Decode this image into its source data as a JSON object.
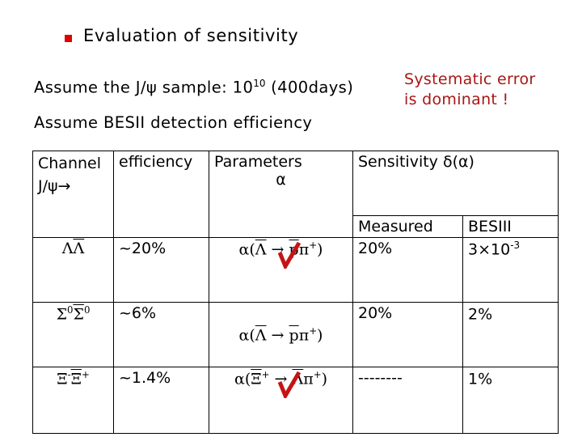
{
  "slide": {
    "title": "Evaluation of sensitivity",
    "bullet_color": "#e00000",
    "assumptions": {
      "sample_prefix": "Assume the J/ψ sample: 10",
      "sample_exponent": "10",
      "sample_suffix": "(400days)",
      "efficiency_line": "Assume BESII detection efficiency"
    },
    "note": {
      "line1": "Systematic error",
      "line2": "is dominant !",
      "color": "#a81616"
    }
  },
  "table": {
    "headers": {
      "channel_line1": "Channel",
      "channel_line2": "J/ψ→",
      "efficiency": "efficiency",
      "parameters_line1": "Parameters",
      "parameters_line2": "α",
      "sensitivity": "Sensitivity δ(α)",
      "measured": "Measured",
      "besiii": "BESIII"
    },
    "rows": [
      {
        "channel_a": "Λ",
        "channel_b": "Λ",
        "channel_b_bar": true,
        "channel_a_sup": "",
        "channel_b_sup": "",
        "efficiency": "~20%",
        "parameter_alpha": "α(",
        "parameter_parent": "Λ",
        "parameter_parent_sup": "",
        "parameter_arrow": "→",
        "parameter_child1": "p",
        "parameter_child2": "π",
        "parameter_child2_sup": "+",
        "parameter_close": ")",
        "checkmark": true,
        "measured": "20%",
        "besiii": "3×10",
        "besiii_sup": "-3"
      },
      {
        "channel_a": "Σ",
        "channel_b": "Σ",
        "channel_b_bar": true,
        "channel_a_sup": "0",
        "channel_b_sup": "0",
        "efficiency": "~6%",
        "parameter_alpha": "α(",
        "parameter_parent": "Λ",
        "parameter_parent_sup": "",
        "parameter_arrow": "→",
        "parameter_child1": "p",
        "parameter_child2": "π",
        "parameter_child2_sup": "+",
        "parameter_close": ")",
        "checkmark": false,
        "measured": "20%",
        "besiii": "2%",
        "besiii_sup": ""
      },
      {
        "channel_a": "Ξ",
        "channel_b": "Ξ",
        "channel_b_bar": true,
        "channel_a_sup": "-",
        "channel_b_sup": "+",
        "efficiency": "~1.4%",
        "parameter_alpha": "α(",
        "parameter_parent": "Ξ",
        "parameter_parent_sup": "+",
        "parameter_arrow": "→",
        "parameter_child1": "Λ",
        "parameter_child2": "π",
        "parameter_child2_sup": "+",
        "parameter_close": ")",
        "checkmark": true,
        "measured": "--------",
        "besiii": "1%",
        "besiii_sup": ""
      }
    ]
  }
}
